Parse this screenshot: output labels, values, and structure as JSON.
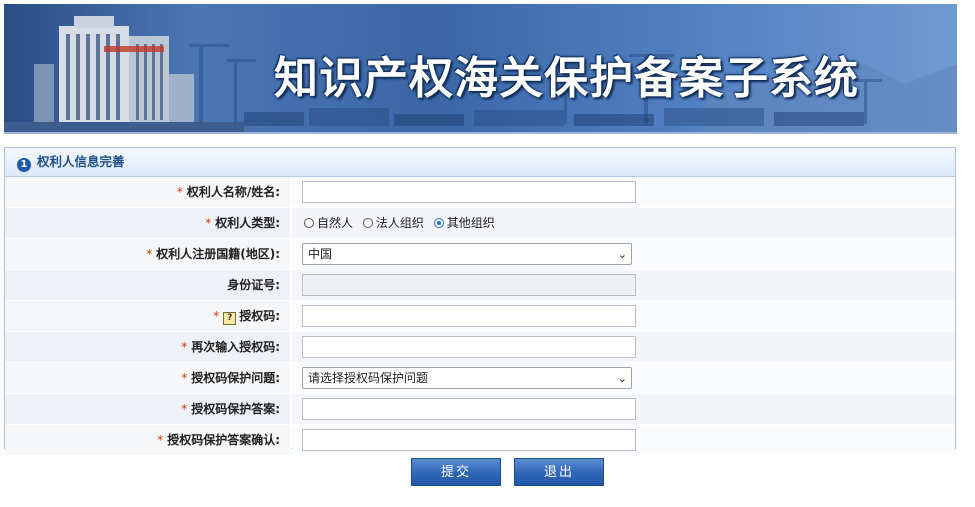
{
  "banner": {
    "title": "知识产权海关保护备案子系统"
  },
  "section": {
    "number": "1",
    "title": "权利人信息完善"
  },
  "form": {
    "name_label": "权利人名称/姓名:",
    "name_value": "",
    "type_label": "权利人类型:",
    "type_options": [
      "自然人",
      "法人组织",
      "其他组织"
    ],
    "type_selected": "其他组织",
    "country_label": "权利人注册国籍(地区):",
    "country_value": "中国",
    "id_label": "身份证号:",
    "id_value": "",
    "auth_label": "授权码:",
    "auth_help": "?",
    "auth_value": "",
    "auth_repeat_label": "再次输入授权码:",
    "auth_repeat_value": "",
    "question_label": "授权码保护问题:",
    "question_value": "请选择授权码保护问题",
    "answer_label": "授权码保护答案:",
    "answer_value": "",
    "answer_confirm_label": "授权码保护答案确认:",
    "answer_confirm_value": "",
    "required_mark": "*"
  },
  "buttons": {
    "submit": "提交",
    "exit": "退出"
  },
  "colors": {
    "accent": "#1d4f8c",
    "required": "#d03a00",
    "button": "#2f65b3"
  }
}
